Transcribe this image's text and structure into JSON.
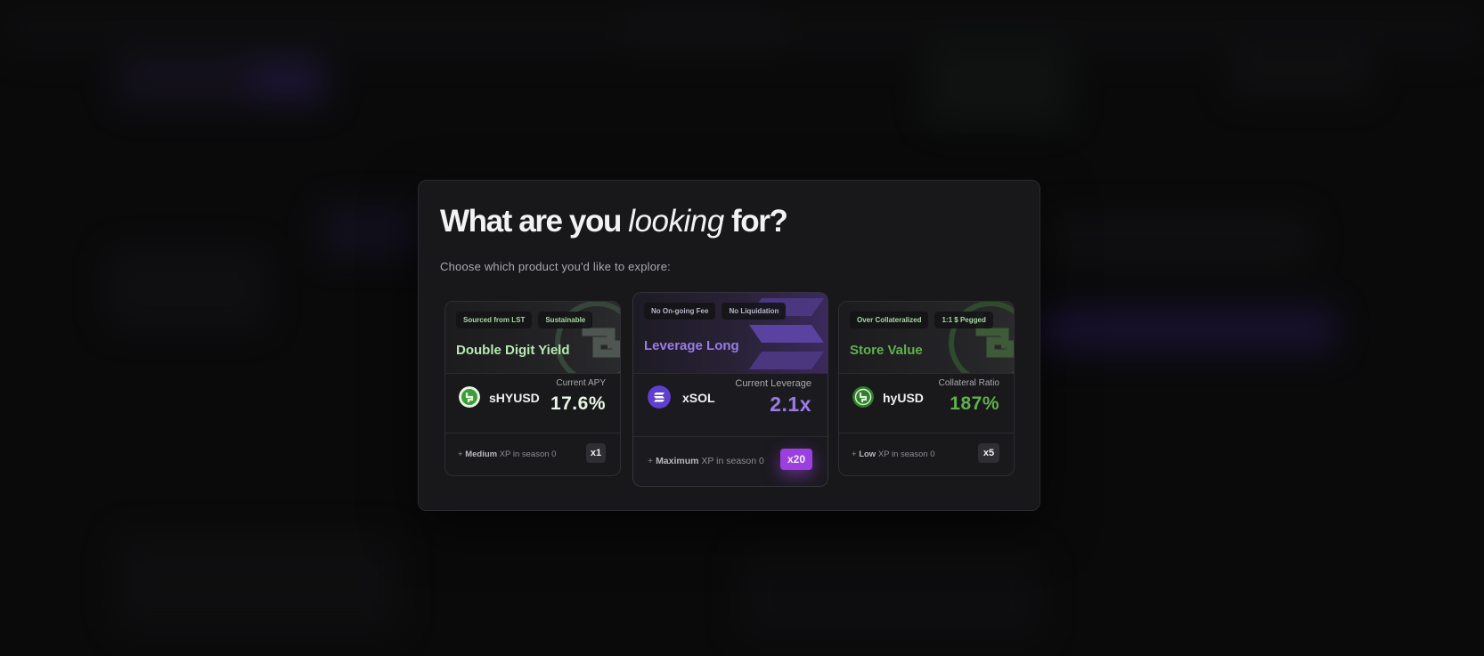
{
  "modal": {
    "title_prefix": "What are you ",
    "title_emphasis": "looking",
    "title_suffix": " for?",
    "subtitle": "Choose which product you'd like to explore:"
  },
  "cards": [
    {
      "tags": [
        "Sourced from LST",
        "Sustainable"
      ],
      "title": "Double Digit Yield",
      "token": "sHYUSD",
      "metric_label": "Current APY",
      "metric_value": "17.6%",
      "xp_prefix": "+ ",
      "xp_level": "Medium",
      "xp_suffix": " XP in season 0",
      "multiplier": "x1",
      "accent": "#b6eab1",
      "icon": "shyusd-token-icon"
    },
    {
      "tags": [
        "No On-going Fee",
        "No Liquidation"
      ],
      "title": "Leverage Long",
      "token": "xSOL",
      "metric_label": "Current Leverage",
      "metric_value": "2.1x",
      "xp_prefix": "+ ",
      "xp_level": "Maximum",
      "xp_suffix": " XP in season 0",
      "multiplier": "x20",
      "accent": "#9b7be6",
      "icon": "xsol-token-icon"
    },
    {
      "tags": [
        "Over Collateralized",
        "1:1 $ Pegged"
      ],
      "title": "Store Value",
      "token": "hyUSD",
      "metric_label": "Collateral Ratio",
      "metric_value": "187%",
      "xp_prefix": "+ ",
      "xp_level": "Low",
      "xp_suffix": " XP in season 0",
      "multiplier": "x5",
      "accent": "#5fb14c",
      "icon": "hyusd-token-icon"
    }
  ],
  "colors": {
    "modal_bg": "#18181a",
    "multiplier_highlight": "#9b3fe0"
  }
}
